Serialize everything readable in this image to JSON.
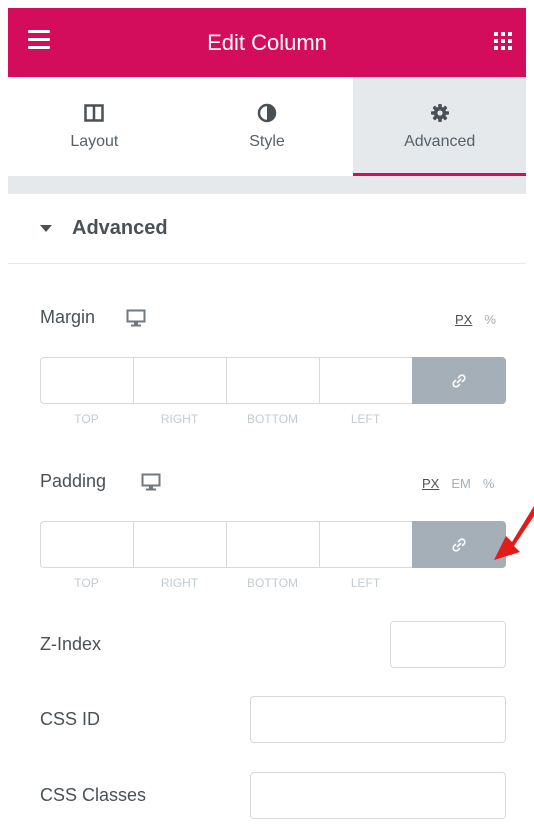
{
  "header": {
    "title": "Edit Column",
    "menu_icon": "hamburger-icon",
    "apps_icon": "grid-icon"
  },
  "tabs": [
    {
      "label": "Layout",
      "icon": "columns-icon",
      "active": false
    },
    {
      "label": "Style",
      "icon": "half-circle-icon",
      "active": false
    },
    {
      "label": "Advanced",
      "icon": "gear-icon",
      "active": true
    }
  ],
  "section": {
    "title": "Advanced"
  },
  "margin": {
    "label": "Margin",
    "units": [
      "PX",
      "%"
    ],
    "active_unit": "PX",
    "fields": [
      "TOP",
      "RIGHT",
      "BOTTOM",
      "LEFT"
    ],
    "values": [
      "",
      "",
      "",
      ""
    ]
  },
  "padding": {
    "label": "Padding",
    "units": [
      "PX",
      "EM",
      "%"
    ],
    "active_unit": "PX",
    "fields": [
      "TOP",
      "RIGHT",
      "BOTTOM",
      "LEFT"
    ],
    "values": [
      "",
      "",
      "",
      ""
    ]
  },
  "z_index": {
    "label": "Z-Index",
    "value": ""
  },
  "css_id": {
    "label": "CSS ID",
    "value": ""
  },
  "css_classes": {
    "label": "CSS Classes",
    "value": ""
  },
  "colors": {
    "brand": "#d30c5c",
    "link_button": "#a4afb7",
    "arrow": "#e21b1b"
  }
}
